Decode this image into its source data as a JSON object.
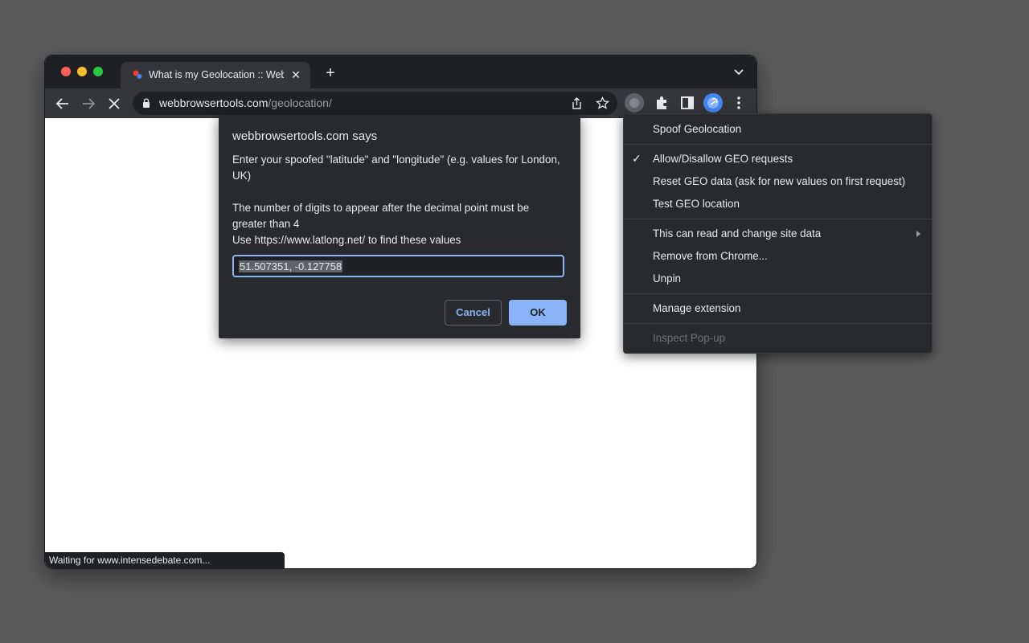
{
  "browser": {
    "tab": {
      "title": "What is my Geolocation :: WebBrowserTools"
    },
    "address": {
      "host": "webbrowsertools.com",
      "path": "/geolocation/"
    },
    "status": "Waiting for www.intensedebate.com..."
  },
  "dialog": {
    "title": "webbrowsertools.com says",
    "message_line1": "Enter your spoofed \"latitude\" and \"longitude\" (e.g. values for London, UK)",
    "message_line2": "The number of digits to appear after the decimal point must be greater than 4",
    "message_line3": "Use https://www.latlong.net/ to find these values",
    "input_value": "51.507351, -0.127758",
    "cancel_label": "Cancel",
    "ok_label": "OK"
  },
  "context_menu": {
    "header": "Spoof Geolocation",
    "items": [
      {
        "label": "Allow/Disallow GEO requests",
        "checked": true
      },
      {
        "label": "Reset GEO data (ask for new values on first request)"
      },
      {
        "label": "Test GEO location"
      },
      {
        "label": "This can read and change site data",
        "has_submenu": true
      },
      {
        "label": "Remove from Chrome..."
      },
      {
        "label": "Unpin"
      },
      {
        "label": "Manage extension"
      },
      {
        "label": "Inspect Pop-up",
        "disabled": true
      }
    ]
  },
  "colors": {
    "accent": "#8ab4f8",
    "dialog_bg": "#292a2d",
    "desktop_bg": "#5b5b5b"
  }
}
